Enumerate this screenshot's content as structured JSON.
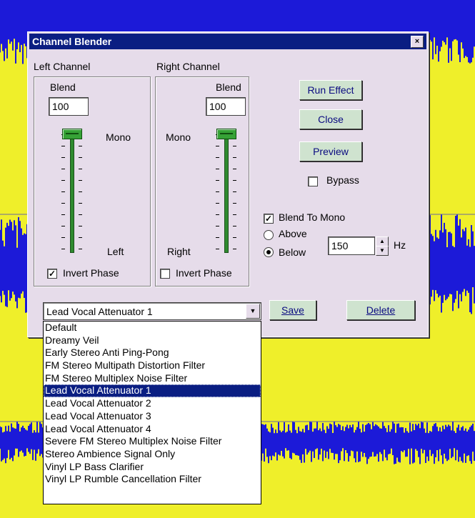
{
  "colors": {
    "waveform_background": "#efef2a",
    "waveform_signal": "#1c1ad8",
    "dialog_background": "#e6dcea",
    "titlebar": "#0a1e82",
    "slider": "#2f8a2f"
  },
  "dialog": {
    "title": "Channel Blender",
    "close_glyph": "×"
  },
  "left_channel": {
    "group_label": "Left Channel",
    "blend_label": "Blend",
    "blend_value": "100",
    "top_label": "Mono",
    "bottom_label": "Left",
    "slider_position": 1.0,
    "invert_phase_label": "Invert Phase",
    "invert_phase_checked": true
  },
  "right_channel": {
    "group_label": "Right Channel",
    "blend_label": "Blend",
    "blend_value": "100",
    "top_label": "Mono",
    "bottom_label": "Right",
    "slider_position": 1.0,
    "invert_phase_label": "Invert Phase",
    "invert_phase_checked": false
  },
  "buttons": {
    "run_effect": "Run Effect",
    "close": "Close",
    "preview": "Preview",
    "save": "Save",
    "delete": "Delete"
  },
  "bypass": {
    "label": "Bypass",
    "checked": false
  },
  "blend_to_mono": {
    "label": "Blend To Mono",
    "checked": true,
    "above_label": "Above",
    "below_label": "Below",
    "selected": "Below",
    "frequency_value": "150",
    "unit": "Hz"
  },
  "preset": {
    "selected": "Lead Vocal Attenuator 1",
    "options": [
      "Default",
      "Dreamy Veil",
      "Early Stereo Anti Ping-Pong",
      "FM Stereo Multipath Distortion Filter",
      "FM Stereo Multiplex Noise Filter",
      "Lead Vocal Attenuator 1",
      "Lead Vocal Attenuator 2",
      "Lead Vocal Attenuator 3",
      "Lead Vocal Attenuator 4",
      "Severe FM Stereo Multiplex Noise Filter",
      "Stereo Ambience Signal Only",
      "Vinyl LP Bass Clarifier",
      "Vinyl LP Rumble Cancellation Filter"
    ]
  }
}
